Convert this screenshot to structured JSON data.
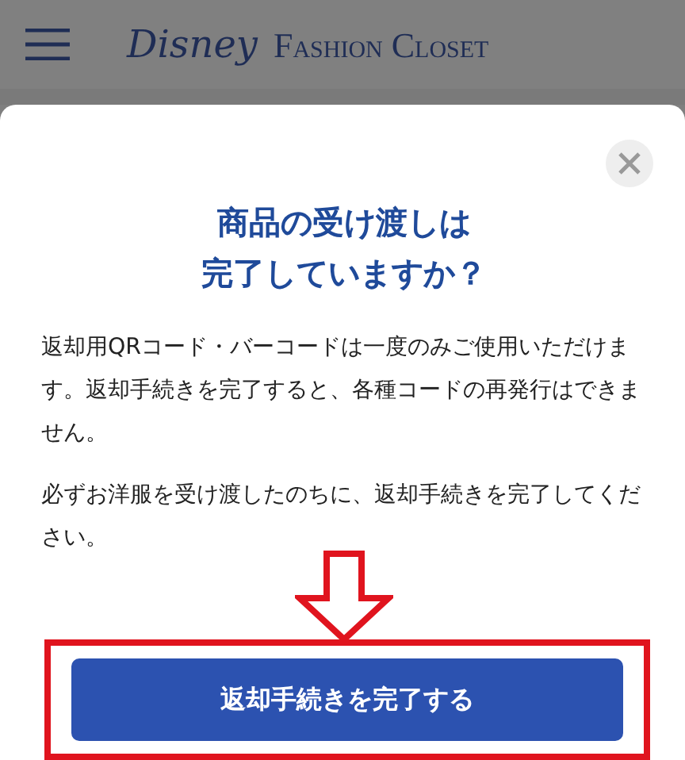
{
  "header": {
    "logo": "Disney",
    "brand": "Fashion Closet"
  },
  "dialog": {
    "title_lines": [
      "商品の受け渡しは",
      "完了していますか？"
    ],
    "paragraphs": [
      "返却用QRコード・バーコードは一度のみご使用いただけます。返却手続きを完了すると、各種コードの再発行はできません。",
      "必ずお洋服を受け渡したのちに、返却手続きを完了してください。"
    ],
    "button": "返却手続きを完了する"
  }
}
